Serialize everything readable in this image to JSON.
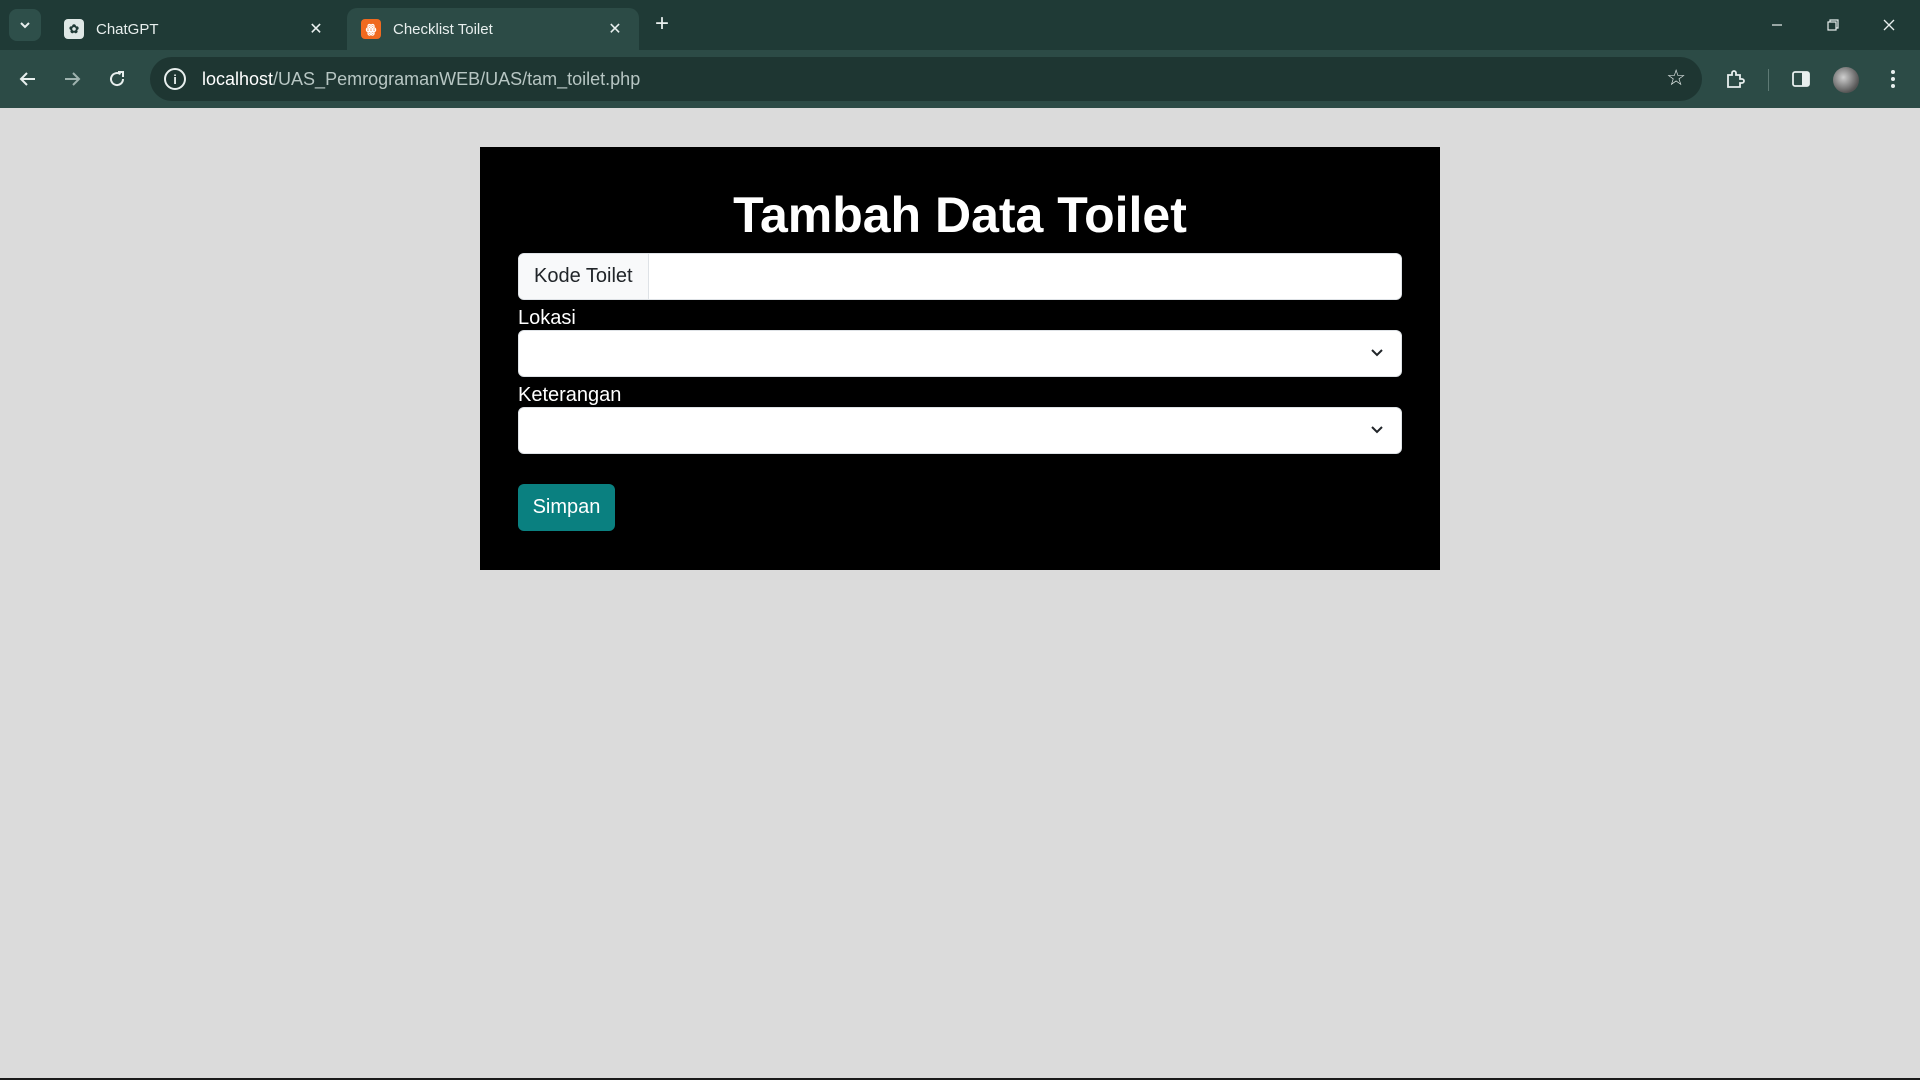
{
  "browser": {
    "tabs": [
      {
        "title": "ChatGPT",
        "favicon": "chatgpt-icon",
        "active": false
      },
      {
        "title": "Checklist Toilet",
        "favicon": "xampp-icon",
        "active": true
      }
    ],
    "url_host": "localhost",
    "url_path": "/UAS_PemrogramanWEB/UAS/tam_toilet.php"
  },
  "form": {
    "title": "Tambah Data Toilet",
    "kode_label": "Kode Toilet",
    "kode_value": "",
    "lokasi_label": "Lokasi",
    "lokasi_value": "",
    "keterangan_label": "Keterangan",
    "keterangan_value": "",
    "submit_label": "Simpan"
  },
  "colors": {
    "page_bg": "#dbdbdb",
    "card_bg": "#000000",
    "button": "#0a8080",
    "chrome": "#1f3a36"
  }
}
